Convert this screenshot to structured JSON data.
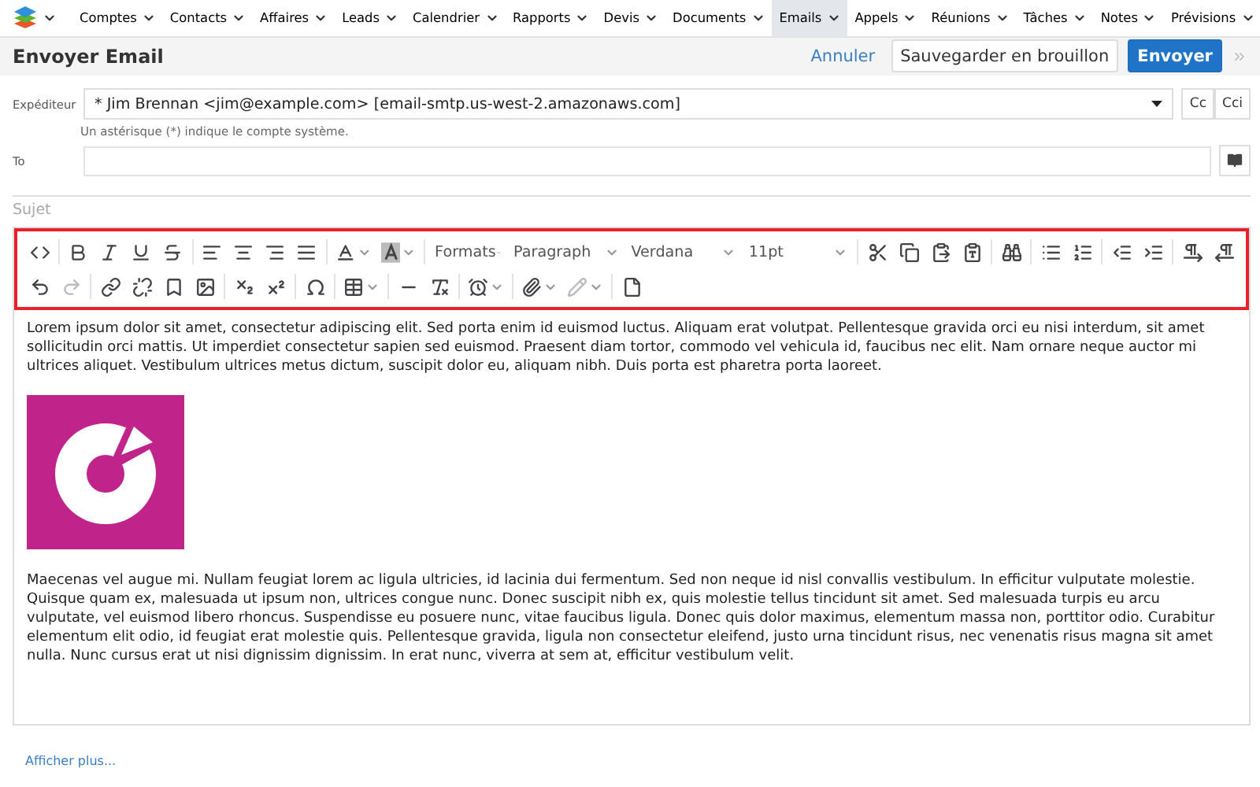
{
  "nav": {
    "items": [
      {
        "label": "Comptes",
        "selected": false
      },
      {
        "label": "Contacts",
        "selected": false
      },
      {
        "label": "Affaires",
        "selected": false
      },
      {
        "label": "Leads",
        "selected": false
      },
      {
        "label": "Calendrier",
        "selected": false
      },
      {
        "label": "Rapports",
        "selected": false
      },
      {
        "label": "Devis",
        "selected": false
      },
      {
        "label": "Documents",
        "selected": false
      },
      {
        "label": "Emails",
        "selected": true
      },
      {
        "label": "Appels",
        "selected": false
      },
      {
        "label": "Réunions",
        "selected": false
      },
      {
        "label": "Tâches",
        "selected": false
      },
      {
        "label": "Notes",
        "selected": false
      },
      {
        "label": "Prévisions",
        "selected": false
      }
    ]
  },
  "header": {
    "title": "Envoyer Email",
    "cancel": "Annuler",
    "draft": "Sauvegarder en brouillon",
    "send": "Envoyer"
  },
  "form": {
    "from_label": "Expéditeur",
    "from_value": "* Jim Brennan <jim@example.com> [email-smtp.us-west-2.amazonaws.com]",
    "cc": "Cc",
    "bcc": "Cci",
    "hint": "Un astérisque (*) indique le compte système.",
    "to_label": "To",
    "subject_placeholder": "Sujet"
  },
  "toolbar": {
    "formats": "Formats",
    "block": "Paragraph",
    "font": "Verdana",
    "size": "11pt"
  },
  "body": {
    "paragraphs": [
      "Lorem ipsum dolor sit amet, consectetur adipiscing elit. Sed porta enim id euismod luctus. Aliquam erat volutpat. Pellentesque gravida orci eu nisi interdum, sit amet sollicitudin orci mattis. Ut imperdiet consectetur sapien sed euismod. Praesent diam tortor, commodo vel vehicula id, faucibus nec elit. Nam ornare neque auctor mi ultrices aliquet. Vestibulum ultrices metus dictum, suscipit dolor eu, aliquam nibh. Duis porta est pharetra porta laoreet.",
      "Maecenas vel augue mi. Nullam feugiat lorem ac ligula ultricies, id lacinia dui fermentum. Sed non neque id nisl convallis vestibulum. In efficitur vulputate molestie. Quisque quam ex, malesuada ut ipsum non, ultrices congue nunc. Donec suscipit nibh ex, quis molestie tellus tincidunt sit amet. Sed malesuada turpis eu arcu vulputate, vel euismod libero rhoncus. Suspendisse eu posuere nunc, vitae faucibus ligula. Donec quis dolor maximus, elementum massa non, porttitor odio. Curabitur elementum elit odio, id feugiat erat molestie quis. Pellentesque gravida, ligula non consectetur eleifend, justo urna tincidunt risus, nec venenatis risus magna sit amet nulla. Nunc cursus erat ut nisi dignissim dignissim. In erat nunc, viverra at sem at, efficitur vestibulum velit."
    ]
  },
  "footer": {
    "more_link": "Afficher plus..."
  }
}
